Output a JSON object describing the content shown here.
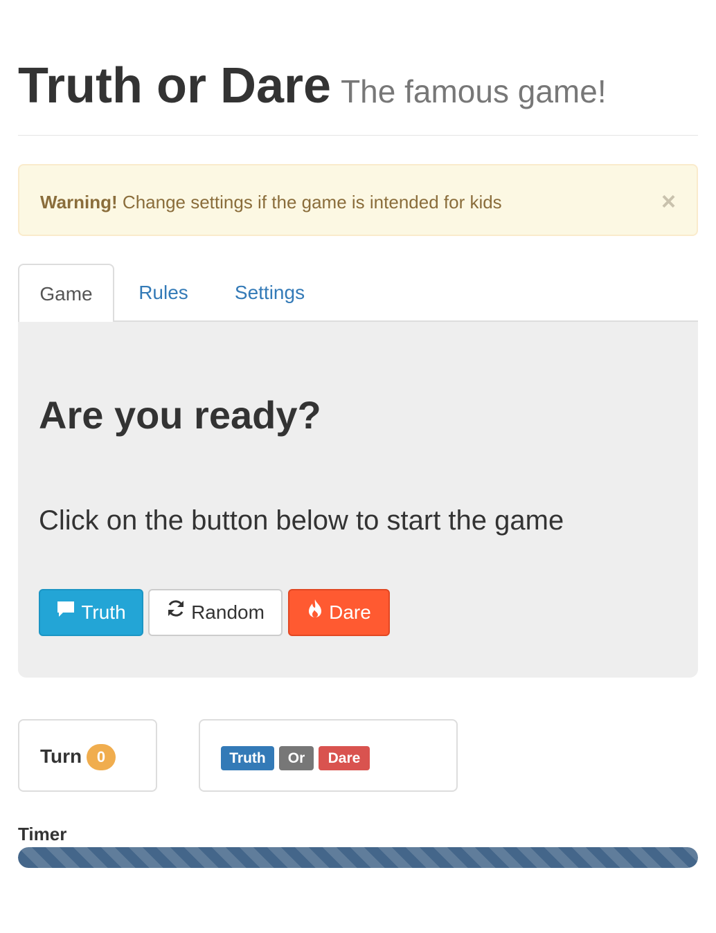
{
  "header": {
    "title": "Truth or Dare",
    "subtitle": "The famous game!"
  },
  "alert": {
    "strong": "Warning!",
    "message": "Change settings if the game is intended for kids",
    "close_symbol": "×",
    "color": "#fcf8e3"
  },
  "tabs": [
    {
      "label": "Game",
      "active": true
    },
    {
      "label": "Rules",
      "active": false
    },
    {
      "label": "Settings",
      "active": false
    }
  ],
  "game": {
    "heading": "Are you ready?",
    "lead": "Click on the button below to start the game",
    "buttons": {
      "truth": {
        "label": "Truth",
        "icon": "comment-icon",
        "color": "#23a5d6"
      },
      "random": {
        "label": "Random",
        "icon": "refresh-icon",
        "color": "#ffffff"
      },
      "dare": {
        "label": "Dare",
        "icon": "fire-icon",
        "color": "#ff5a31"
      }
    }
  },
  "status": {
    "turn_label": "Turn",
    "turn_count": "0",
    "labels": {
      "truth": "Truth",
      "or": "Or",
      "dare": "Dare"
    }
  },
  "timer": {
    "label": "Timer",
    "progress": 1.0,
    "color": "#44668a"
  }
}
